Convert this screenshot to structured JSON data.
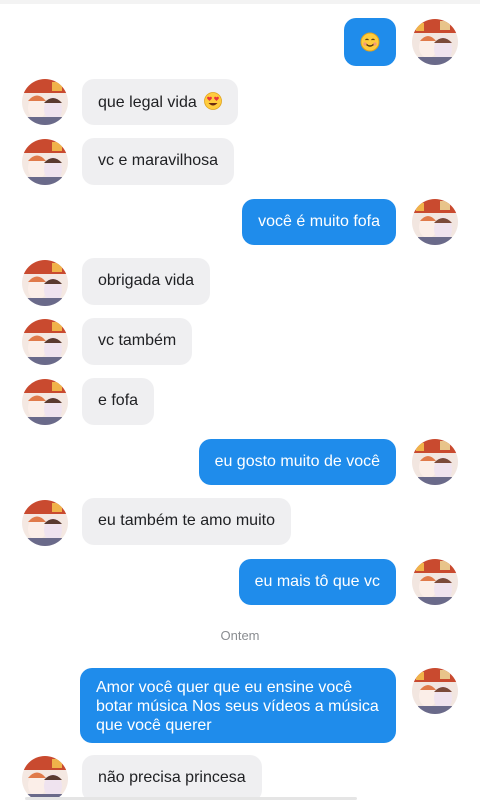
{
  "conversation": {
    "date_divider": "Ontem",
    "messages": [
      {
        "dir": "out",
        "text": "",
        "emoji": "smiling-face-icon"
      },
      {
        "dir": "in",
        "text": "que legal vida",
        "emoji": "heart-eyes-icon"
      },
      {
        "dir": "in",
        "text": "vc e maravilhosa"
      },
      {
        "dir": "out",
        "text": "você é muito fofa"
      },
      {
        "dir": "in",
        "text": "obrigada vida"
      },
      {
        "dir": "in",
        "text": "vc também"
      },
      {
        "dir": "in",
        "text": "e fofa"
      },
      {
        "dir": "out",
        "text": "eu gosto muito de você"
      },
      {
        "dir": "in",
        "text": "eu também te amo muito"
      },
      {
        "dir": "out",
        "text": "eu mais tô que vc"
      },
      {
        "dir": "out",
        "text": "Amor você quer que eu ensine você botar música Nos seus vídeos a música que você querer"
      },
      {
        "dir": "in",
        "text": "não precisa princesa"
      }
    ]
  },
  "colors": {
    "outgoing_bubble": "#1f8ceb",
    "incoming_bubble": "#efeff1",
    "divider_text": "#8a8d91"
  }
}
